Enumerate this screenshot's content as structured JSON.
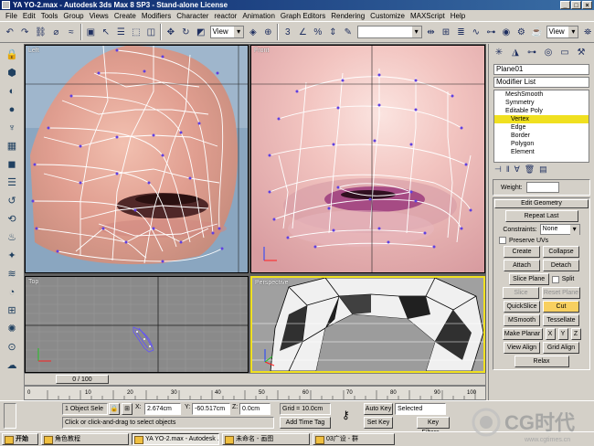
{
  "window": {
    "title": "YA YO-2.max - Autodesk 3ds Max 8 SP3 - Stand-alone License"
  },
  "menu": [
    "File",
    "Edit",
    "Tools",
    "Group",
    "Views",
    "Create",
    "Modifiers",
    "Character",
    "reactor",
    "Animation",
    "Graph Editors",
    "Rendering",
    "Customize",
    "MAXScript",
    "Help"
  ],
  "toolbar": {
    "ref_coord": "View",
    "ref_coord_right": "View"
  },
  "viewports": {
    "left": "Left",
    "front": "Front",
    "top": "Top",
    "perspective": "Perspective"
  },
  "timeslider": {
    "frame": "0 / 100"
  },
  "ruler": {
    "ticks": [
      "0",
      "10",
      "20",
      "30",
      "40",
      "50",
      "60",
      "70",
      "80",
      "90",
      "100"
    ]
  },
  "status": {
    "selection": "1 Object Sele",
    "prompt": "Click or click-and-drag to select objects",
    "x_label": "X:",
    "x_value": "2.674cm",
    "y_label": "Y:",
    "y_value": "-60.517cm",
    "z_label": "Z:",
    "z_value": "0.0cm",
    "grid": "Grid = 10.0cm",
    "add_time_tag": "Add Time Tag",
    "auto_key": "Auto Key",
    "set_key": "Set Key",
    "selected": "Selected",
    "key_filters": "Key Filters..."
  },
  "command_panel": {
    "object_name": "Plane01",
    "modifier_list": "Modifier List",
    "stack": [
      {
        "label": "MeshSmooth",
        "selected": false
      },
      {
        "label": "Symmetry",
        "selected": false
      },
      {
        "label": "Editable Poly",
        "selected": false
      },
      {
        "label": "Vertex",
        "selected": true
      },
      {
        "label": "Edge",
        "selected": false
      },
      {
        "label": "Border",
        "selected": false
      },
      {
        "label": "Polygon",
        "selected": false
      },
      {
        "label": "Element",
        "selected": false
      }
    ],
    "weight_label": "Weight:",
    "edit_geometry": "Edit Geometry",
    "repeat_last": "Repeat Last",
    "constraints_label": "Constraints:",
    "constraints_value": "None",
    "preserve_uvs": "Preserve UVs",
    "create": "Create",
    "collapse": "Collapse",
    "attach": "Attach",
    "detach": "Detach",
    "slice_plane": "Slice Plane",
    "split": "Split",
    "slice": "Slice",
    "reset_plane": "Reset Plane",
    "quickslice": "QuickSlice",
    "cut": "Cut",
    "msmooth": "MSmooth",
    "tessellate": "Tessellate",
    "make_planar": "Make Planar",
    "x": "X",
    "y": "Y",
    "z": "Z",
    "view_align": "View Align",
    "grid_align": "Grid Align",
    "relax": "Relax"
  },
  "taskbar": {
    "start": "开始",
    "tasks": [
      "角色教程",
      "YA YO-2.max - Autodesk ...",
      "未命名 - 画图",
      "03广设 - 群"
    ]
  },
  "watermark": {
    "logo": "CG时代",
    "url": "www.cgtimes.cn"
  }
}
